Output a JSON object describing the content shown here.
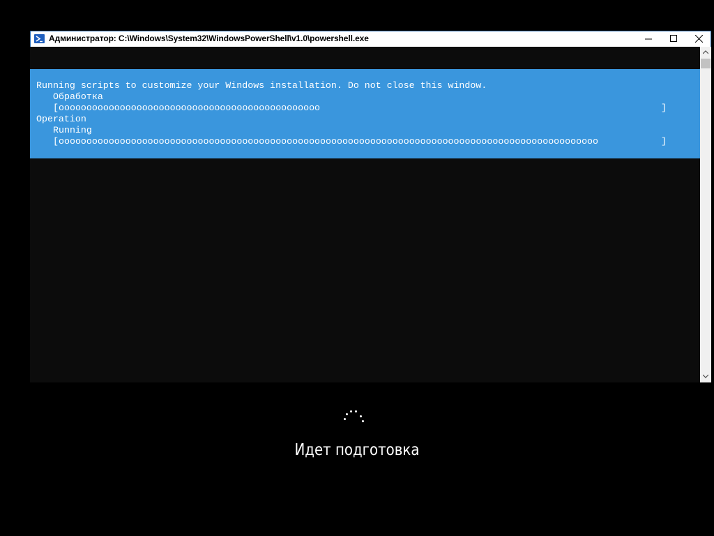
{
  "window": {
    "title": "Администратор: C:\\Windows\\System32\\WindowsPowerShell\\v1.0\\powershell.exe",
    "icon": "powershell-icon",
    "controls": [
      "minimize-icon",
      "maximize-icon",
      "close-icon"
    ]
  },
  "console": {
    "header_line": "Running scripts to customize your Windows installation. Do not close this window.",
    "activities": [
      {
        "activity": "Обработка",
        "progress_chars": 47,
        "progress_fraction": 0.51,
        "char": "o"
      },
      {
        "activity": "Operation",
        "status": "Running",
        "progress_chars": 97,
        "progress_fraction": 1.0,
        "char": "o"
      }
    ],
    "bracket_open": "[",
    "bracket_close": "]",
    "colors": {
      "background": "#0c0c0c",
      "progress_background": "#3a96dd",
      "text": "#ffffff"
    }
  },
  "setup": {
    "status": "Идет подготовка",
    "spinner": "loading-spinner-icon",
    "background": "#000000"
  }
}
